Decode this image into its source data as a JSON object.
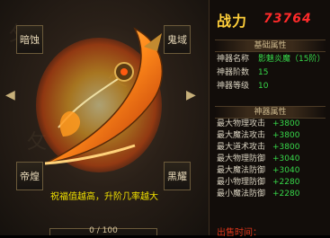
{
  "slots": {
    "top_left": "暗蚀",
    "top_right": "鬼域",
    "bottom_left": "帝煌",
    "bottom_right": "黑耀"
  },
  "hint_text": "祝福值越高，升阶几率越大",
  "progress": {
    "label": "0 / 100",
    "value": 0
  },
  "power": {
    "label": "战力",
    "value": "73764"
  },
  "basic": {
    "title": "基础属性",
    "rows": [
      {
        "key": "神器名称",
        "value": "影魅炎魔（15阶）"
      },
      {
        "key": "神器阶数",
        "value": "15"
      },
      {
        "key": "神器等级",
        "value": "10"
      }
    ]
  },
  "attrs": {
    "title": "神器属性",
    "rows": [
      {
        "key": "最大物理攻击",
        "value": "+3800"
      },
      {
        "key": "最大魔法攻击",
        "value": "+3800"
      },
      {
        "key": "最大道术攻击",
        "value": "+3800"
      },
      {
        "key": "最大物理防御",
        "value": "+3040"
      },
      {
        "key": "最大魔法防御",
        "value": "+3040"
      },
      {
        "key": "最小物理防御",
        "value": "+2280"
      },
      {
        "key": "最小魔法防御",
        "value": "+2280"
      }
    ]
  },
  "footer": "出售时间：",
  "colors": {
    "accent": "#ffcf3a",
    "power_value": "#ff2a2a",
    "attr_value": "#37d84a"
  }
}
